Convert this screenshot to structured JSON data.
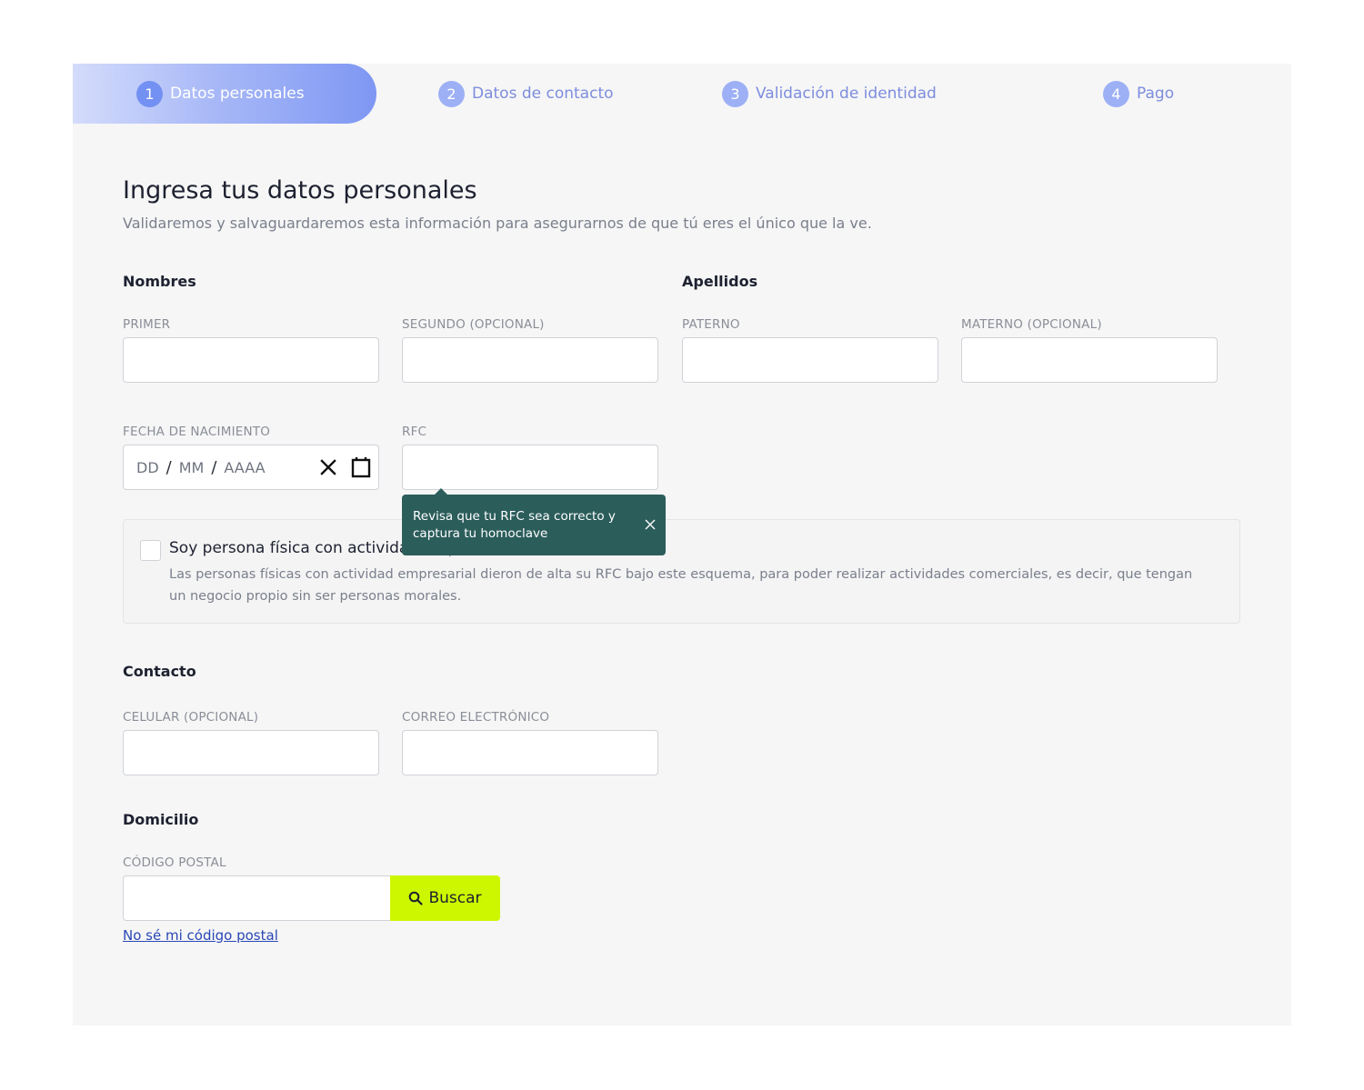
{
  "stepper": {
    "steps": [
      {
        "number": "1",
        "label": "Datos personales",
        "active": true
      },
      {
        "number": "2",
        "label": "Datos de contacto",
        "active": false
      },
      {
        "number": "3",
        "label": "Validación de identidad",
        "active": false
      },
      {
        "number": "4",
        "label": "Pago",
        "active": false
      }
    ]
  },
  "header": {
    "title": "Ingresa tus datos personales",
    "subtitle": "Validaremos y salvaguardaremos esta información para asegurarnos de que tú eres el único que la ve."
  },
  "names": {
    "section": "Nombres",
    "first_label": "PRIMER",
    "second_label": "SEGUNDO (OPCIONAL)"
  },
  "surnames": {
    "section": "Apellidos",
    "paternal_label": "PATERNO",
    "maternal_label": "MATERNO (OPCIONAL)"
  },
  "birthdate": {
    "label": "FECHA DE NACIMIENTO",
    "day": "DD",
    "month": "MM",
    "year": "AAAA",
    "separator": "/"
  },
  "rfc": {
    "label": "RFC",
    "tooltip": "Revisa que tu RFC sea correcto y captura tu homoclave"
  },
  "business": {
    "title": "Soy persona física con actividad empresarial",
    "description": "Las personas físicas con actividad empresarial dieron de alta su RFC bajo este esquema, para poder realizar actividades comerciales, es decir, que tengan un negocio propio sin ser personas morales."
  },
  "contact": {
    "section": "Contacto",
    "phone_label": "CELULAR (OPCIONAL)",
    "email_label": "CORREO ELECTRÓNICO"
  },
  "address": {
    "section": "Domicilio",
    "zip_label": "CÓDIGO POSTAL",
    "search_label": "Buscar",
    "unknown_zip_link": "No sé mi código postal"
  },
  "colors": {
    "accent": "#7391f2",
    "tooltip_bg": "#2b5d5b",
    "search_button": "#cdf700",
    "link": "#2947b5"
  },
  "icons": {
    "clear": "close-icon",
    "calendar": "calendar-icon",
    "search": "search-icon"
  }
}
